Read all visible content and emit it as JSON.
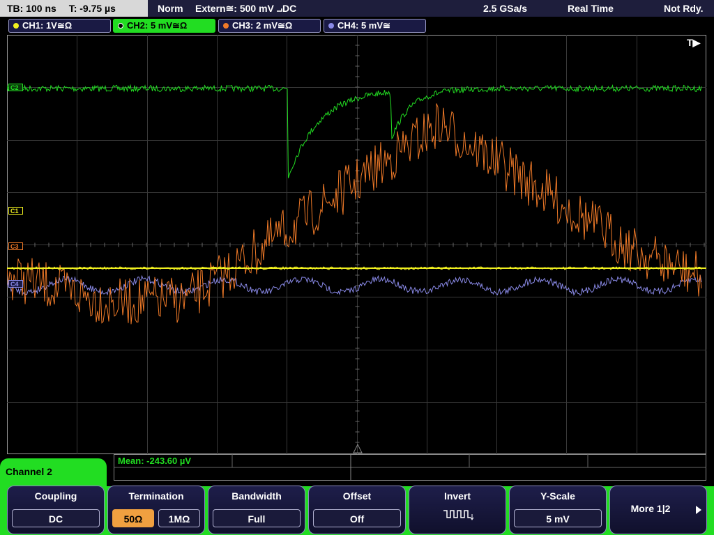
{
  "status": {
    "timebase": "TB: 100 ns",
    "trigger_time": "T: -9.75 µs",
    "trigger_mode": "Norm",
    "trigger_source": "Extern≅: 500 mV ⨼DC",
    "sample_rate": "2.5 GSa/s",
    "acq_mode": "Real Time",
    "trigger_status": "Not Rdy."
  },
  "channels": [
    {
      "label": "CH1: 1V≅Ω",
      "color": "#f0f020"
    },
    {
      "label": "CH2: 5 mV≅Ω",
      "color": "#22dd22"
    },
    {
      "label": "CH3: 2 mV≅Ω",
      "color": "#f07a28"
    },
    {
      "label": "CH4: 5 mV≅",
      "color": "#8a8ae8"
    }
  ],
  "markers": {
    "trigger_position": "T▶",
    "ch1": "C1",
    "ch2": "C2",
    "ch3": "C3",
    "ch4": "C4"
  },
  "measurement": {
    "mean": "Mean: -243.60 µV"
  },
  "menu": {
    "title": "Channel 2"
  },
  "softkeys": {
    "coupling": {
      "label": "Coupling",
      "value": "DC"
    },
    "termination": {
      "label": "Termination",
      "opt1": "50Ω",
      "opt2": "1MΩ"
    },
    "bandwidth": {
      "label": "Bandwidth",
      "value": "Full"
    },
    "offset": {
      "label": "Offset",
      "value": "Off"
    },
    "invert": {
      "label": "Invert",
      "icon": "invert-waveform-icon"
    },
    "yscale": {
      "label": "Y-Scale",
      "value": "5 mV"
    },
    "more": {
      "label": "More 1|2"
    }
  },
  "colors": {
    "ch1": "#f0f020",
    "ch2": "#22dd22",
    "ch3": "#f07a28",
    "ch4": "#8a8ae8",
    "grid": "#3a3a3a"
  }
}
